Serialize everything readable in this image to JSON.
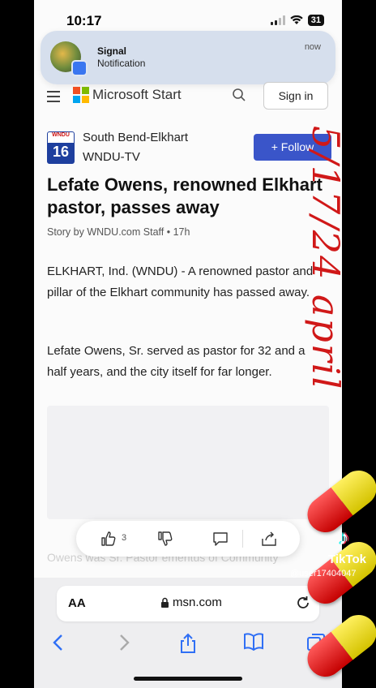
{
  "status": {
    "time": "10:17",
    "battery": "31"
  },
  "notification": {
    "title": "Signal",
    "subtitle": "Notification",
    "time": "now"
  },
  "header": {
    "brand": "Microsoft Start",
    "signin_label": "Sign in"
  },
  "source": {
    "logo_top": "WNDU",
    "logo_num": "16",
    "name_line1": "South Bend-Elkhart",
    "name_line2": "WNDU-TV",
    "follow_label": "+ Follow"
  },
  "article": {
    "headline": "Lefate Owens, renowned Elkhart pastor, passes away",
    "byline": "Story by WNDU.com Staff • 17h",
    "paragraph1": "ELKHART, Ind. (WNDU) - A renowned pastor and pillar of the Elkhart community has passed away.",
    "paragraph2": "Lefate Owens, Sr. served as pastor for 32 and a half years, and the city itself for far longer.",
    "faded_text": "Owens was Sr. Pastor emeritus of Community"
  },
  "reactions": {
    "like_count": "3"
  },
  "browser": {
    "aa_label": "AA",
    "url": "msn.com"
  },
  "overlay": {
    "handwriting": "5/17/24 april",
    "tiktok_logo": "♪",
    "tiktok_name": "TikTok",
    "tiktok_user": "@user17404047"
  },
  "colors": {
    "follow": "#3a55c9",
    "handwriting": "#d01818"
  }
}
